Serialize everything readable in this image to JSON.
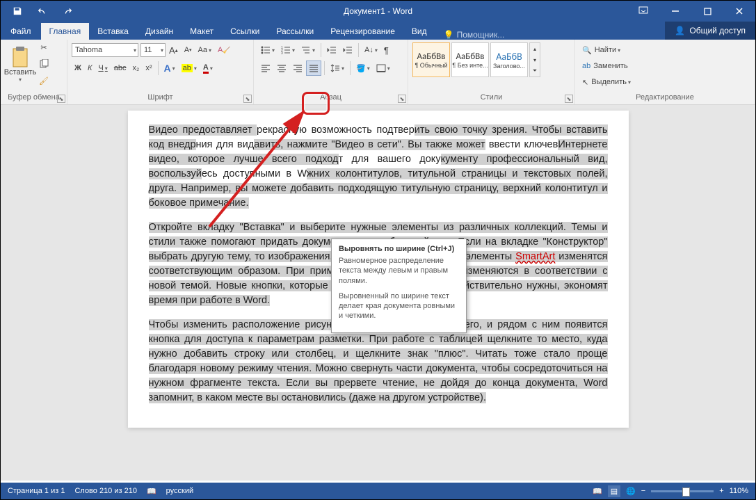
{
  "title": "Документ1 - Word",
  "tabs": {
    "file": "Файл",
    "list": [
      "Главная",
      "Вставка",
      "Дизайн",
      "Макет",
      "Ссылки",
      "Рассылки",
      "Рецензирование",
      "Вид"
    ],
    "tell": "Помощник...",
    "share": "Общий доступ"
  },
  "ribbon": {
    "clipboard": {
      "label": "Буфер обмена",
      "paste": "Вставить"
    },
    "font": {
      "label": "Шрифт",
      "name": "Tahoma",
      "size": "11",
      "bold": "Ж",
      "italic": "К",
      "underline": "Ч",
      "strike": "abc",
      "sub": "x₂",
      "sup": "x²",
      "case": "Aa",
      "clear": "🧹"
    },
    "paragraph": {
      "label": "Абзац"
    },
    "styles": {
      "label": "Стили",
      "items": [
        {
          "preview": "АаБбВв",
          "name": "¶ Обычный"
        },
        {
          "preview": "АаБбВв",
          "name": "¶ Без инте..."
        },
        {
          "preview": "АаБбВ",
          "name": "Заголово..."
        }
      ]
    },
    "editing": {
      "label": "Редактирование",
      "find": "Найти",
      "replace": "Заменить",
      "select": "Выделить"
    }
  },
  "tooltip": {
    "title": "Выровнять по ширине (Ctrl+J)",
    "p1": "Равномерное распределение текста между левым и правым полями.",
    "p2": "Выровненный по ширине текст делает края документа ровными и четкими."
  },
  "document": {
    "p1a": "Видео предоставляет ",
    "p1b": "рекрасную возможность подтвер",
    "p1c": "ить свою точку зрения. Чтобы вставить код внедр",
    "p1d": "ния для вид",
    "p1e": "авить, нажмите \"Видео в сети\". Вы также может",
    "p1f": " ввести ключев",
    "p1g": "Интернете видео, которое лучше всего подход",
    "p1h": "т для вашего доку",
    "p1i": "кументу профессиональный вид, воспользуй",
    "p1j": "есь доступными в W",
    "p1k": "жних колонтитулов, титульной страницы и текстовых полей, ",
    "p1l": " друга. Например, вы можете добавить подходящую титульную страницу, верхний колонтитул и боковое примечание.",
    "p2a": "Откройте вкладку \"Вставка\" и выберите нужные элементы из различных коллекций. Темы и стили также помогают придать документу единообразный вид. Если на вкладке \"Конструктор\" выбрать другую тему, то изображения, диаграммы и графические элементы ",
    "p2smart": "SmartArt",
    "p2b": " изменятся соответствующим образом. При применении стилей заголовки изменяются в соответствии с новой темой. Новые кнопки, которые видны, только если они действительно нужны, экономят время при работе в Word.",
    "p3": "Чтобы изменить расположение рисунка в документе, щелкните его, и рядом с ним появится кнопка для доступа к параметрам разметки. При работе с таблицей щелкните то место, куда нужно добавить строку или столбец, и щелкните знак \"плюс\". Читать тоже стало проще благодаря новому режиму чтения. Можно свернуть части документа, чтобы сосредоточиться на нужном фрагменте текста. Если вы прервете чтение, не дойдя до конца документа, Word запомнит, в каком месте вы остановились (даже на другом устройстве)."
  },
  "status": {
    "page": "Страница 1 из 1",
    "words": "Слово 210 из 210",
    "lang": "русский",
    "zoom": "110%"
  }
}
